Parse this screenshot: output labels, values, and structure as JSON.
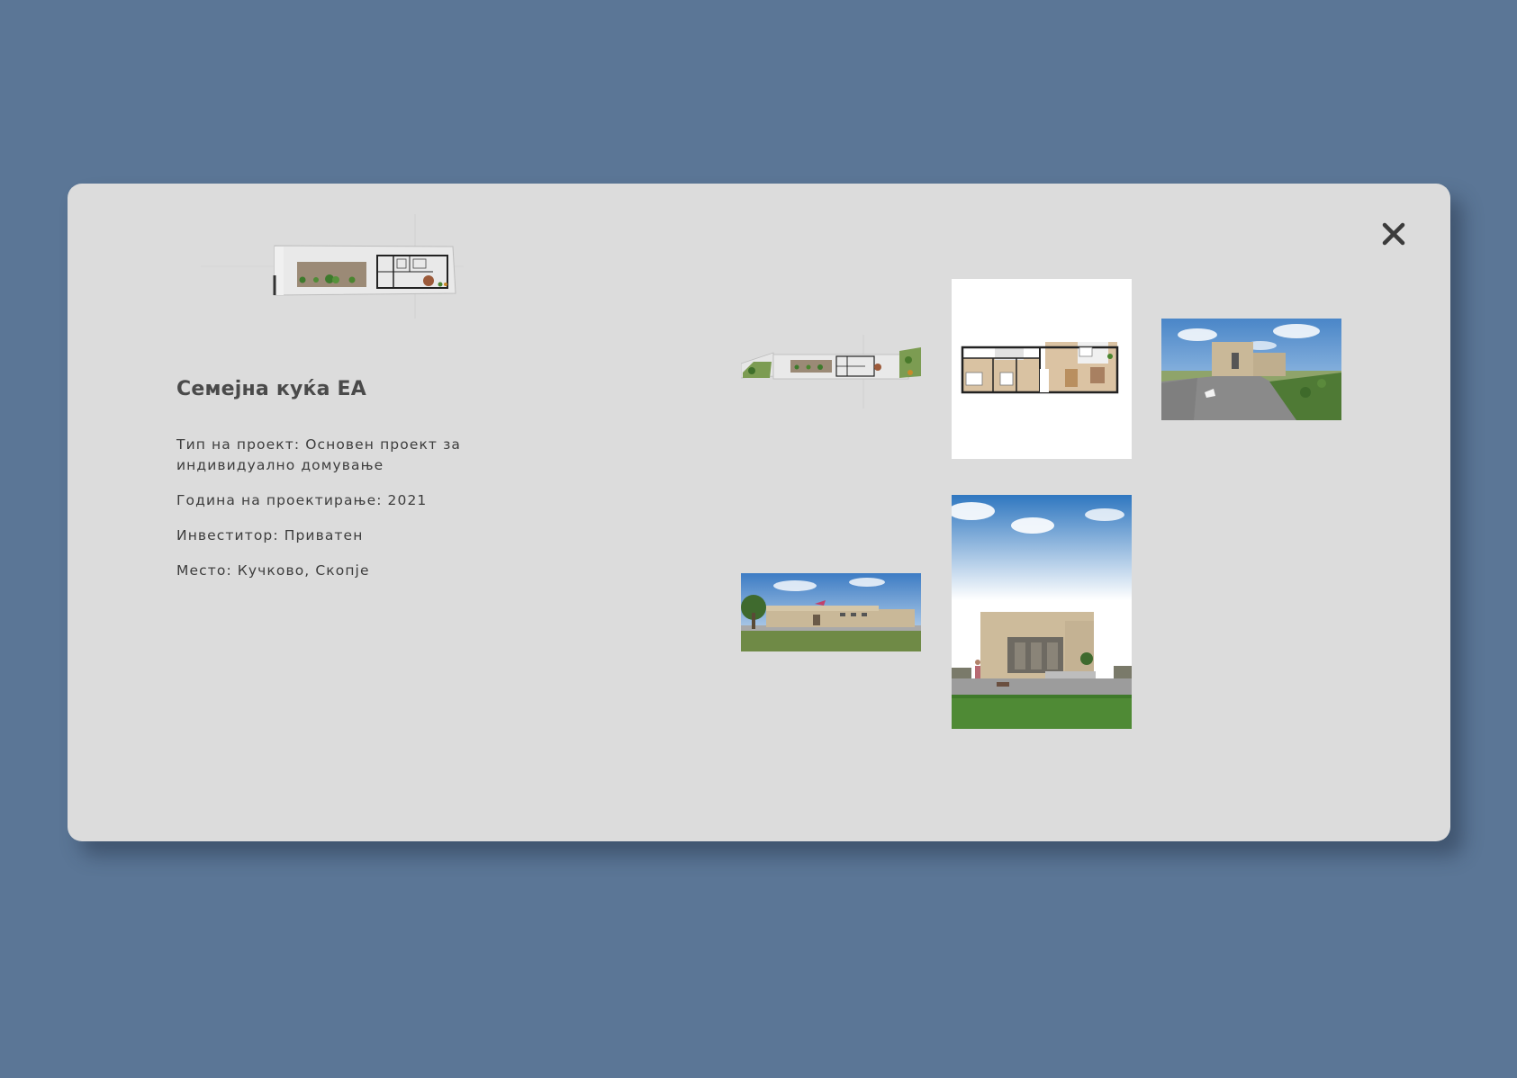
{
  "project": {
    "title": "Семејна куќа ЕА",
    "details": {
      "type": "Тип на проект: Основен проект за индивидуално домување",
      "year": "Година на проектирање: 2021",
      "investor": "Инвеститор: Приватен",
      "location": "Место: Кучково, Скопје"
    }
  },
  "icons": {
    "close": "close-icon"
  },
  "colors": {
    "page_background": "#5b7696",
    "modal_background": "#dcdcdc",
    "text": "#3d3d3d"
  }
}
